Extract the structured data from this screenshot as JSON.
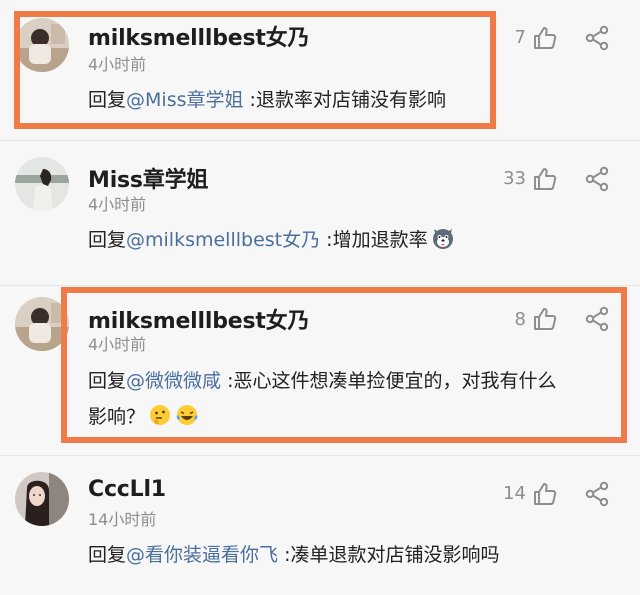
{
  "colors": {
    "highlight": "#f07a48",
    "mention": "#4a6f9e",
    "meta": "#8e8e8e"
  },
  "comments": [
    {
      "username": "milksmelllbest女乃",
      "time": "4小时前",
      "reply_prefix": "回复",
      "mention": "@Miss章学姐",
      "text": " :退款率对店铺没有影响",
      "likes": "7"
    },
    {
      "username": "Miss章学姐",
      "time": "4小时前",
      "reply_prefix": "回复",
      "mention": "@milksmelllbest女乃",
      "text": " :增加退款率",
      "likes": "33",
      "emoji": "husky-dog-emoji"
    },
    {
      "username": "milksmelllbest女乃",
      "time": "4小时前",
      "reply_prefix": "回复",
      "mention": "@微微微咸",
      "text": " :恶心这件想凑单捡便宜的，对我有什么",
      "text_line2": "影响？",
      "likes": "8",
      "emoji": [
        "thinking-face-emoji",
        "crying-laughing-emoji"
      ]
    },
    {
      "username": "CccLl1",
      "time": "14小时前",
      "reply_prefix": "回复",
      "mention": "@看你装逼看你飞",
      "text": " :凑单退款对店铺没影响吗",
      "likes": "14"
    }
  ]
}
